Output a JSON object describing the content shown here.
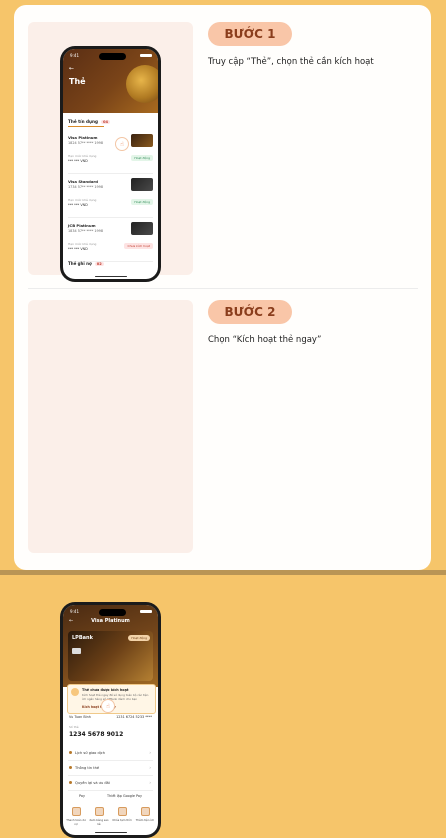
{
  "steps": [
    {
      "badge": "BƯỚC 1",
      "text": "Truy cập “Thẻ”, chọn thẻ cần kích hoạt"
    },
    {
      "badge": "BƯỚC 2",
      "text": "Chọn “Kích hoạt thẻ ngay”"
    }
  ],
  "phone1": {
    "time": "9:41",
    "title": "Thẻ",
    "tab_label": "Thẻ tín dụng",
    "tab_count": "04",
    "cards": [
      {
        "name": "Visa Platinum",
        "number": "1824 57** **** 1998",
        "limit_label": "Hạn mức khả dụng",
        "limit": "*** *** VND",
        "status": "Hoạt động"
      },
      {
        "name": "Visa Standard",
        "number": "1734 57** **** 1998",
        "limit_label": "Hạn mức khả dụng",
        "limit": "*** *** VND",
        "status": "Hoạt động"
      },
      {
        "name": "JCB Platinum",
        "number": "1834 57** **** 1998",
        "limit_label": "Hạn mức khả dụng",
        "limit": "*** *** VND",
        "status": "Chưa kích hoạt"
      }
    ],
    "debit_label": "Thẻ ghi nợ",
    "debit_count": "02"
  },
  "phone2": {
    "time": "9:41",
    "title": "Visa Platinum",
    "brand": "LPBank",
    "card_pill": "Hoạt động",
    "tooltip_title": "Thẻ chưa được kích hoạt",
    "tooltip_body": "Kích hoạt thẻ ngay để sử dụng toàn bộ các tiện ích ngân hàng số LPBank dành cho bạn",
    "tooltip_button": "Kích hoạt thẻ ngay",
    "holder": "Vu Tuan Binh",
    "masked": "1231 6724 5233 ****",
    "account_label": "Số thẻ",
    "account_number": "1234 5678 9012",
    "menu": [
      "Lịch sử giao dịch",
      "Thông tin thẻ",
      "Quyền lợi và ưu đãi"
    ],
    "pay_apple": "Pay",
    "pay_google": "Thiết lập Google Pay",
    "actions": [
      "Thanh toán dư nợ",
      "Xem bảng sao kê",
      "Khóa tạm thời",
      "Thêm tiện ích"
    ]
  }
}
